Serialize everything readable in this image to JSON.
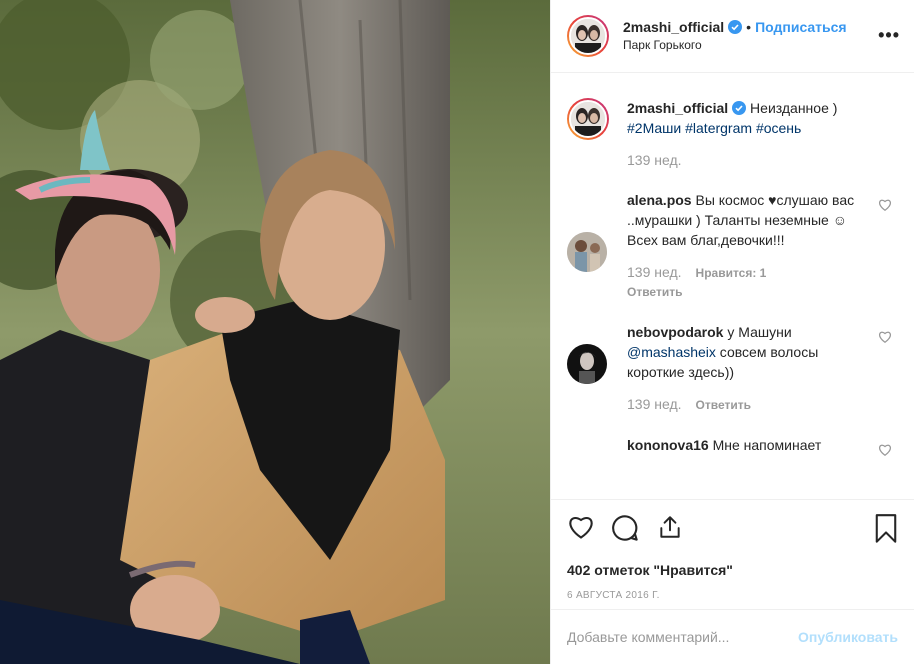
{
  "post": {
    "username": "2mashi_official",
    "dot": "•",
    "follow_label": "Подписаться",
    "location": "Парк Горького",
    "more_label": "•••"
  },
  "caption": {
    "username": "2mashi_official",
    "text": "Неизданное )",
    "hashtags": [
      "#2Маши",
      "#latergram",
      "#осень"
    ],
    "time": "139 нед."
  },
  "comments": [
    {
      "username": "alena.pos",
      "text_parts": [
        "Вы космос ",
        "♥",
        "слушаю вас ..мурашки ) Таланты неземные ",
        "☺",
        "Всех вам благ,девочки!!!"
      ],
      "time": "139 нед.",
      "likes": "Нравится: 1",
      "reply": "Ответить"
    },
    {
      "username": "nebovpodarok",
      "text_before": "у Машуни ",
      "mention": "@mashasheix",
      "text_after": " совсем волосы короткие здесь))",
      "time": "139 нед.",
      "reply": "Ответить"
    },
    {
      "username": "kononova16",
      "text": "Мне напоминает"
    }
  ],
  "actions": {
    "likes_text": "402 отметок \"Нравится\"",
    "date": "6 АВГУСТА 2016 Г."
  },
  "add_comment": {
    "placeholder": "Добавьте комментарий...",
    "publish": "Опубликовать"
  },
  "icons": {
    "verified": "verified-badge-icon",
    "like": "heart-icon",
    "comment": "comment-bubble-icon",
    "share": "share-icon",
    "save": "bookmark-icon",
    "comment_like": "small-heart-icon",
    "more": "more-options-icon"
  },
  "colors": {
    "link": "#3897f0",
    "hashtag": "#003569",
    "muted": "#999999",
    "publish_disabled": "#b2dffc"
  }
}
